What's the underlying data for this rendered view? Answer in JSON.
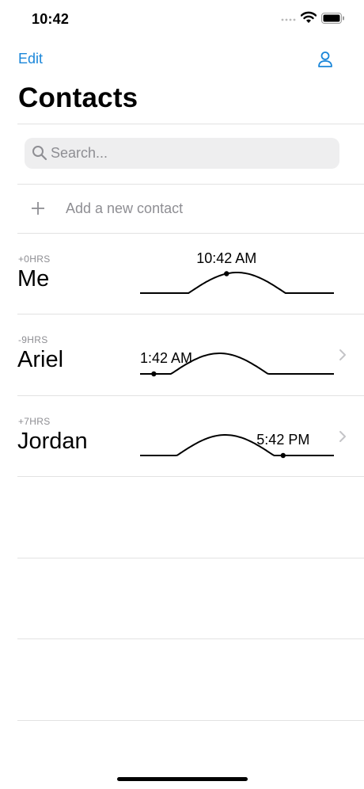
{
  "status_bar": {
    "time": "10:42"
  },
  "nav": {
    "edit_label": "Edit"
  },
  "title": "Contacts",
  "search": {
    "placeholder": "Search..."
  },
  "add_contact": {
    "label": "Add a new contact"
  },
  "contacts": [
    {
      "offset": "+0HRS",
      "name": "Me",
      "time": "10:42 AM",
      "day_fraction": 0.446,
      "has_chevron": false
    },
    {
      "offset": "-9HRS",
      "name": "Ariel",
      "time": "1:42 AM",
      "day_fraction": 0.071,
      "has_chevron": true
    },
    {
      "offset": "+7HRS",
      "name": "Jordan",
      "time": "5:42 PM",
      "day_fraction": 0.738,
      "has_chevron": true
    }
  ],
  "colors": {
    "accent": "#1a86d9",
    "secondary_text": "#8e8e93",
    "divider": "#e2e2e2",
    "search_bg": "#eeeeef"
  }
}
